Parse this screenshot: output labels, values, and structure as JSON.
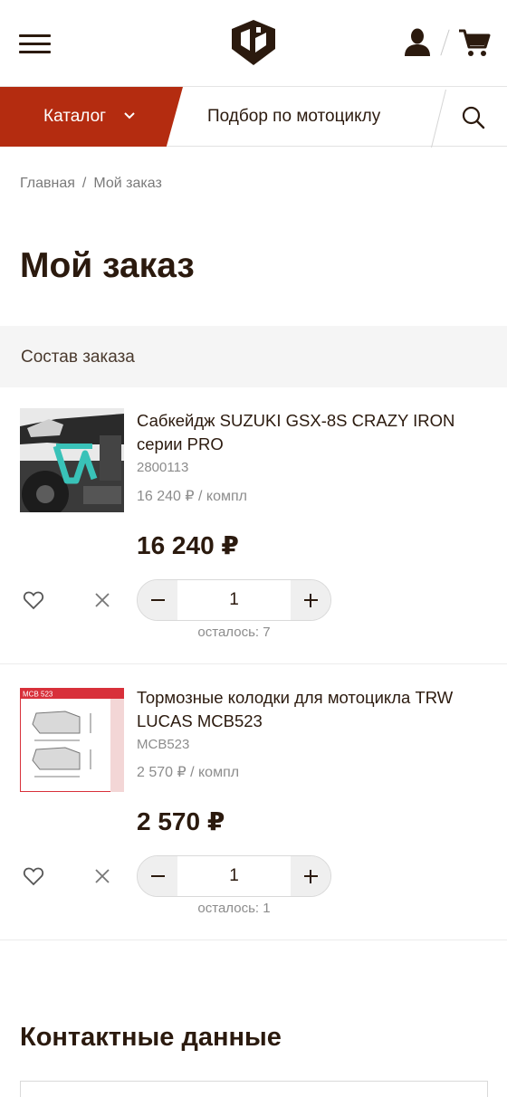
{
  "header": {
    "menu_icon": "burger-menu-icon",
    "logo_icon": "brand-logo",
    "user_icon": "user-icon",
    "cart_icon": "cart-icon"
  },
  "nav": {
    "catalog_label": "Каталог",
    "select_bike_label": "Подбор по мотоциклу",
    "search_icon": "search-icon",
    "accent_color": "#b42c10"
  },
  "breadcrumb": {
    "home": "Главная",
    "separator": "/",
    "current": "Мой заказ"
  },
  "page_title": "Мой заказ",
  "order_section_label": "Состав заказа",
  "items": [
    {
      "name": "Сабкейдж SUZUKI GSX-8S CRAZY IRON серии PRO",
      "sku": "2800113",
      "unit_price": "16 240 ₽ / компл",
      "price": "16 240 ₽",
      "quantity": "1",
      "stock": "осталось: 7"
    },
    {
      "name": "Тормозные колодки для мотоцикла TRW LUCAS MCB523",
      "sku": "MCB523",
      "unit_price": "2 570 ₽ / компл",
      "price": "2 570 ₽",
      "quantity": "1",
      "stock": "осталось: 1",
      "image_label": "MCB 523"
    }
  ],
  "contacts_title": "Контактные данные"
}
